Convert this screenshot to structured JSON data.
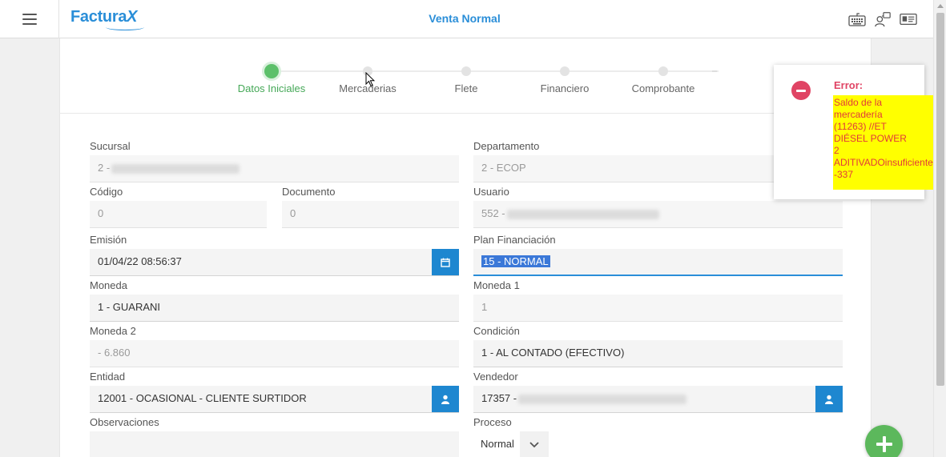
{
  "app": {
    "brand": "Factura",
    "brand_x": "X",
    "title": "Venta Normal"
  },
  "icons": {
    "menu": "hamburger-icon",
    "keyboard": "keyboard-icon",
    "users": "users-network-icon",
    "id_card": "id-card-icon",
    "calendar": "calendar-icon",
    "user": "user-icon",
    "chevron": "chevron-down-icon",
    "error": "minus-circle-icon",
    "add": "plus-icon"
  },
  "colors": {
    "accent": "#2a8ed8",
    "step_active": "#5cc06a",
    "error": "#e04464",
    "highlight": "#ffff00",
    "fab": "#5cb85c"
  },
  "stepper": {
    "steps": [
      {
        "label": "Datos Iniciales",
        "active": true
      },
      {
        "label": "Mercaderias",
        "active": false
      },
      {
        "label": "Flete",
        "active": false
      },
      {
        "label": "Financiero",
        "active": false
      },
      {
        "label": "Comprobante",
        "active": false
      }
    ]
  },
  "form": {
    "sucursal": {
      "label": "Sucursal",
      "value": "2 -"
    },
    "codigo": {
      "label": "Código",
      "value": "0"
    },
    "documento": {
      "label": "Documento",
      "value": "0"
    },
    "emision": {
      "label": "Emisión",
      "value": "01/04/22 08:56:37"
    },
    "moneda": {
      "label": "Moneda",
      "value": "1 - GUARANI"
    },
    "moneda2": {
      "label": "Moneda 2",
      "value": "- 6.860"
    },
    "entidad": {
      "label": "Entidad",
      "value": "12001 - OCASIONAL - CLIENTE SURTIDOR"
    },
    "observaciones": {
      "label": "Observaciones",
      "value": ""
    },
    "departamento": {
      "label": "Departamento",
      "value": "2 - ECOP"
    },
    "usuario": {
      "label": "Usuario",
      "value": "552 -"
    },
    "plan": {
      "label": "Plan Financiación",
      "value": "15 - NORMAL"
    },
    "moneda1": {
      "label": "Moneda 1",
      "value": "1"
    },
    "condicion": {
      "label": "Condición",
      "value": "1 - AL CONTADO (EFECTIVO)"
    },
    "vendedor": {
      "label": "Vendedor",
      "value": "17357 -"
    },
    "proceso": {
      "label": "Proceso",
      "value": "Normal"
    }
  },
  "error_toast": {
    "title": "Error:",
    "lines": [
      "Saldo de la",
      "mercadería",
      "(11263) //ET",
      "DIÉSEL POWER",
      "2",
      "ADITIVADOinsuficiente",
      "-337"
    ]
  }
}
